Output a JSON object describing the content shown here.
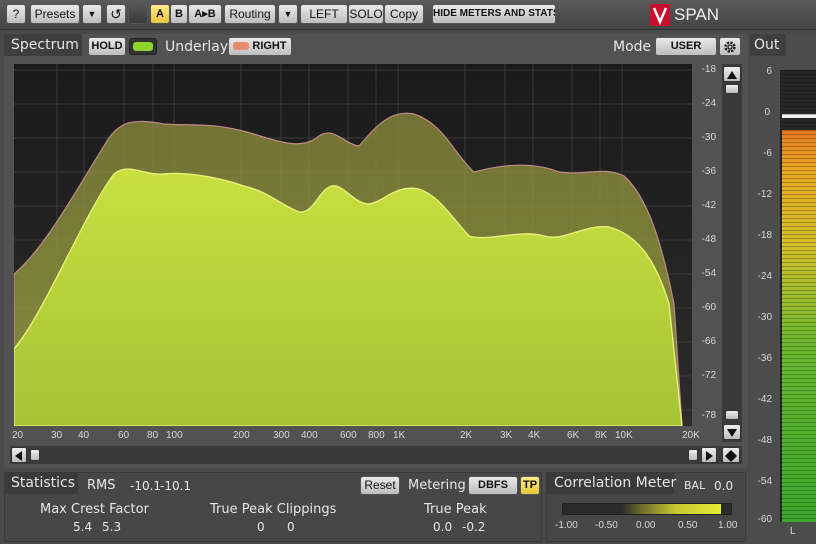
{
  "toolbar": {
    "help_label": "?",
    "presets_label": "Presets",
    "dropdown_glyph": "▼",
    "undo_glyph": "↺",
    "a_label": "A",
    "b_label": "B",
    "ab_label": "A▸B",
    "routing_label": "Routing",
    "left_label": "LEFT",
    "solo_label": "SOLO",
    "copy_label": "Copy",
    "hide_meters_label": "HIDE METERS AND STATS",
    "logo_text": "SPAN"
  },
  "spectrum": {
    "title": "Spectrum",
    "hold_label": "HOLD",
    "underlay_label": "Underlay",
    "right_label": "RIGHT",
    "mode_label": "Mode",
    "mode_value": "USER",
    "db_ticks": [
      "-18",
      "-24",
      "-30",
      "-36",
      "-42",
      "-48",
      "-54",
      "-60",
      "-66",
      "-72",
      "-78"
    ],
    "freq_ticks": [
      "20",
      "30",
      "40",
      "60",
      "80",
      "100",
      "200",
      "300",
      "400",
      "600",
      "800",
      "1K",
      "2K",
      "3K",
      "4K",
      "6K",
      "8K",
      "10K",
      "20K"
    ],
    "colors": {
      "fill_main": "#c4dc3c",
      "fill_peak": "#a8b43c",
      "background": "#242424"
    }
  },
  "out": {
    "title": "Out",
    "scale": [
      "6",
      "0",
      "-6",
      "-12",
      "-18",
      "-24",
      "-30",
      "-36",
      "-42",
      "-48",
      "-54",
      "-60"
    ],
    "channel_l": "L"
  },
  "statistics": {
    "title": "Statistics",
    "rms_label": "RMS",
    "rms_left": "-10.1",
    "rms_right": "-10.1",
    "reset_label": "Reset",
    "metering_label": "Metering",
    "dbfs_label": "DBFS",
    "tp_label": "TP",
    "max_crest_label": "Max Crest Factor",
    "max_crest_left": "5.4",
    "max_crest_right": "5.3",
    "tp_clip_label": "True Peak Clippings",
    "tp_clip_left": "0",
    "tp_clip_right": "0",
    "true_peak_label": "True Peak",
    "true_peak_left": "0.0",
    "true_peak_right": "-0.2"
  },
  "correlation": {
    "title": "Correlation Meter",
    "bal_label": "BAL",
    "bal_value": "0.0",
    "scale": [
      "-1.00",
      "-0.50",
      "0.00",
      "0.50",
      "1.00"
    ]
  }
}
